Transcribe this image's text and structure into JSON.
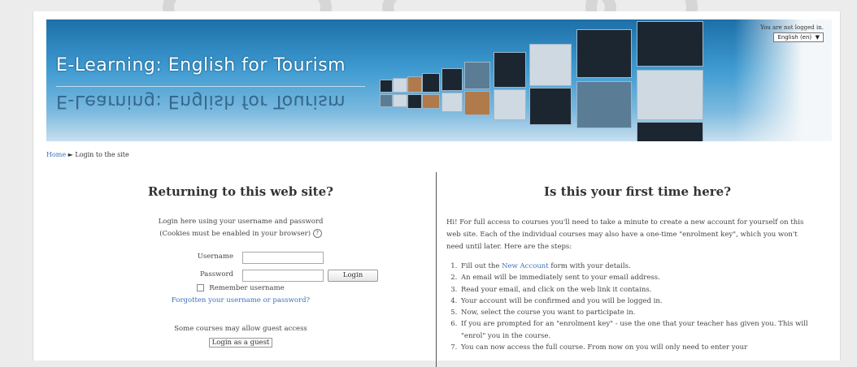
{
  "header": {
    "site_title": "E-Learning: English for Tourism",
    "login_status": "You are not logged in.",
    "language": "English (en)"
  },
  "breadcrumb": {
    "home": "Home",
    "separator": "►",
    "current": "Login to the site"
  },
  "login": {
    "heading": "Returning to this web site?",
    "desc_line1": "Login here using your username and password",
    "desc_line2": "(Cookies must be enabled in your browser)",
    "username_label": "Username",
    "username_value": "",
    "password_label": "Password",
    "password_value": "",
    "login_button": "Login",
    "remember_label": "Remember username",
    "forgot_link": "Forgotten your username or password?",
    "guest_text": "Some courses may allow guest access",
    "guest_button": "Login as a guest"
  },
  "signup": {
    "heading": "Is this your first time here?",
    "intro": "Hi! For full access to courses you'll need to take a minute to create a new account for yourself on this web site. Each of the individual courses may also have a one-time \"enrolment key\", which you won't need until later. Here are the steps:",
    "step1_pre": "Fill out the ",
    "step1_link": "New Account",
    "step1_post": " form with your details.",
    "steps": [
      "An email will be immediately sent to your email address.",
      "Read your email, and click on the web link it contains.",
      "Your account will be confirmed and you will be logged in.",
      "Now, select the course you want to participate in.",
      "If you are prompted for an \"enrolment key\" - use the one that your teacher has given you. This will \"enrol\" you in the course.",
      "You can now access the full course. From now on you will only need to enter your"
    ]
  },
  "colors": {
    "link": "#3b73b9",
    "banner": "#2a82c0"
  },
  "icons": {
    "help": "help-icon",
    "language_dropdown": "chevron-down-icon",
    "remember": "checkbox"
  }
}
